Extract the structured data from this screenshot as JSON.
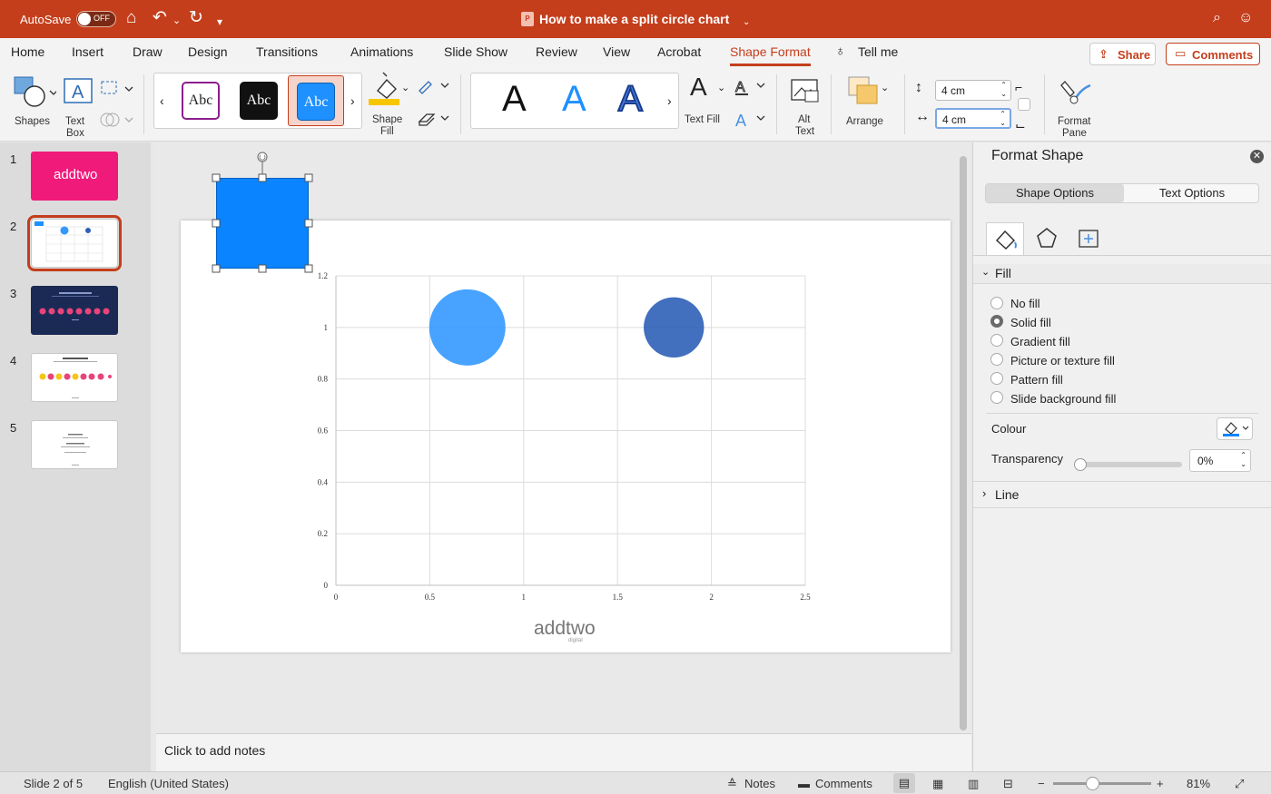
{
  "titlebar": {
    "autosave_label": "AutoSave",
    "autosave_state": "OFF",
    "document_title": "How to make a split circle chart",
    "doc_icon": "P"
  },
  "ribbon_tabs": [
    "Home",
    "Insert",
    "Draw",
    "Design",
    "Transitions",
    "Animations",
    "Slide Show",
    "Review",
    "View",
    "Acrobat",
    "Shape Format",
    "Tell me"
  ],
  "active_tab": "Shape Format",
  "share_label": "Share",
  "comments_label": "Comments",
  "ribbon": {
    "shapes_label": "Shapes",
    "textbox_label1": "Text",
    "textbox_label2": "Box",
    "style_samples": [
      "Abc",
      "Abc",
      "Abc"
    ],
    "shape_fill_label1": "Shape",
    "shape_fill_label2": "Fill",
    "wordart_samples": [
      "A",
      "A",
      "A"
    ],
    "text_fill_label": "Text Fill",
    "alt_text_label1": "Alt",
    "alt_text_label2": "Text",
    "arrange_label": "Arrange",
    "height_value": "4 cm",
    "width_value": "4 cm",
    "format_pane_label1": "Format",
    "format_pane_label2": "Pane"
  },
  "slides": [
    {
      "number": "1"
    },
    {
      "number": "2"
    },
    {
      "number": "3"
    },
    {
      "number": "4"
    },
    {
      "number": "5"
    }
  ],
  "selected_slide": 2,
  "thumb1_text": "addtwo",
  "chart_data": {
    "type": "scatter",
    "title": "",
    "xlabel": "",
    "ylabel": "",
    "xlim": [
      0,
      2.5
    ],
    "ylim": [
      0,
      1.2
    ],
    "x_ticks": [
      "0",
      "0.5",
      "1",
      "1.5",
      "2",
      "2.5"
    ],
    "y_ticks": [
      "0",
      "0.2",
      "0.4",
      "0.6",
      "0.8",
      "1",
      "1.2"
    ],
    "grid": true,
    "series": [
      {
        "x": 0.7,
        "y": 1,
        "size": 4,
        "color": "#3399ff"
      },
      {
        "x": 1.8,
        "y": 1,
        "size": 2.5,
        "color": "#2e5fb7"
      }
    ]
  },
  "slide_logo": "addtwo",
  "slide_logo_sub": "digital",
  "selected_shape_color": "#0a84ff",
  "notes_placeholder": "Click to add notes",
  "format_pane": {
    "title": "Format Shape",
    "tab_shape": "Shape Options",
    "tab_text": "Text Options",
    "fill_header": "Fill",
    "fill_options": [
      "No fill",
      "Solid fill",
      "Gradient fill",
      "Picture or texture fill",
      "Pattern fill",
      "Slide background fill"
    ],
    "selected_fill": "Solid fill",
    "colour_label": "Colour",
    "colour_value": "#0a84ff",
    "transparency_label": "Transparency",
    "transparency_value": "0%",
    "line_header": "Line"
  },
  "status": {
    "slide_info": "Slide 2 of 5",
    "language": "English (United States)",
    "notes_btn": "Notes",
    "comments_btn": "Comments",
    "zoom": "81%"
  },
  "accent_color": "#c43e1c"
}
